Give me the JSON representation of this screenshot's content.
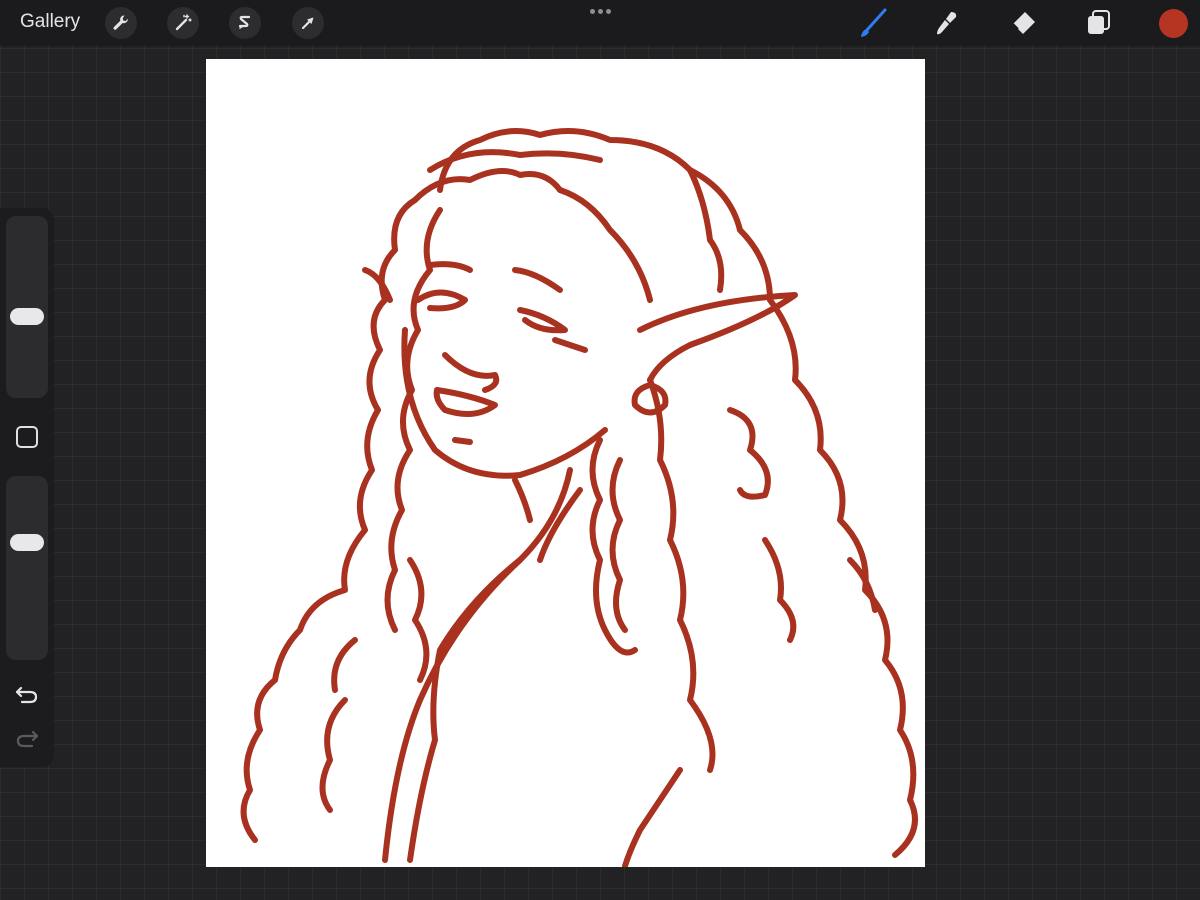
{
  "topbar": {
    "gallery_label": "Gallery",
    "left_tools": [
      "wrench-icon",
      "magic-wand-icon",
      "selection-icon",
      "transform-arrow-icon"
    ],
    "more_icon": "more-dots-icon",
    "right_tools": [
      "brush-icon",
      "smudge-icon",
      "eraser-icon",
      "layers-icon"
    ],
    "active_tool": "brush-icon",
    "active_tool_color": "#2f7cf6",
    "current_color": "#b63422"
  },
  "sidebar": {
    "brush_size_level": 0.44,
    "opacity_level": 0.66,
    "icons": [
      "modify-square-icon",
      "undo-icon",
      "redo-icon"
    ]
  },
  "canvas": {
    "background": "#ffffff",
    "stroke_color": "#a8321f"
  }
}
